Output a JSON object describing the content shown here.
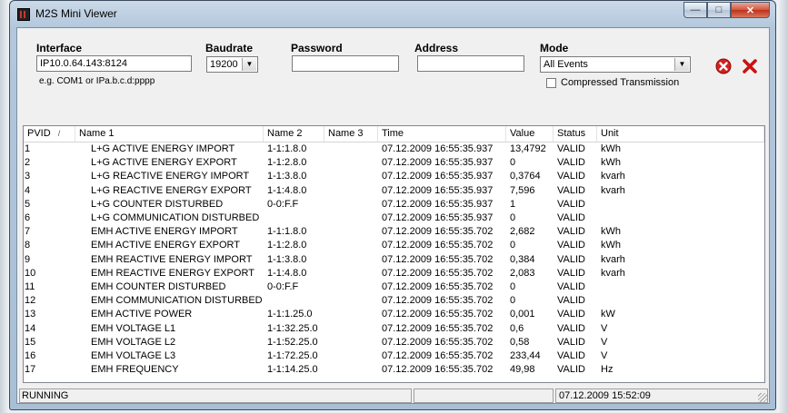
{
  "window": {
    "title": "M2S Mini Viewer"
  },
  "interface": {
    "label": "Interface",
    "value": "IP10.0.64.143:8124",
    "hint": "e.g. COM1 or IPa.b.c.d:pppp"
  },
  "baudrate": {
    "label": "Baudrate",
    "value": "19200"
  },
  "password": {
    "label": "Password",
    "value": ""
  },
  "address": {
    "label": "Address",
    "value": ""
  },
  "mode": {
    "label": "Mode",
    "value": "All Events",
    "compressed_label": "Compressed Transmission",
    "compressed_checked": false
  },
  "table": {
    "columns": [
      "PVID",
      "Name 1",
      "Name 2",
      "Name 3",
      "Time",
      "Value",
      "Status",
      "Unit"
    ],
    "sort_indicator": "/",
    "rows": [
      [
        "1",
        "L+G ACTIVE ENERGY IMPORT",
        "1-1:1.8.0",
        "",
        "07.12.2009 16:55:35.937",
        "13,4792",
        "VALID",
        "kWh"
      ],
      [
        "2",
        "L+G ACTIVE ENERGY EXPORT",
        "1-1:2.8.0",
        "",
        "07.12.2009 16:55:35.937",
        "0",
        "VALID",
        "kWh"
      ],
      [
        "3",
        "L+G REACTIVE ENERGY IMPORT",
        "1-1:3.8.0",
        "",
        "07.12.2009 16:55:35.937",
        "0,3764",
        "VALID",
        "kvarh"
      ],
      [
        "4",
        "L+G REACTIVE ENERGY EXPORT",
        "1-1:4.8.0",
        "",
        "07.12.2009 16:55:35.937",
        "7,596",
        "VALID",
        "kvarh"
      ],
      [
        "5",
        "L+G  COUNTER DISTURBED",
        "0-0:F.F",
        "",
        "07.12.2009 16:55:35.937",
        "1",
        "VALID",
        ""
      ],
      [
        "6",
        "L+G  COMMUNICATION DISTURBED",
        "",
        "",
        "07.12.2009 16:55:35.937",
        "0",
        "VALID",
        ""
      ],
      [
        "7",
        "EMH ACTIVE ENERGY IMPORT",
        "1-1:1.8.0",
        "",
        "07.12.2009 16:55:35.702",
        "2,682",
        "VALID",
        "kWh"
      ],
      [
        "8",
        "EMH ACTIVE ENERGY EXPORT",
        "1-1:2.8.0",
        "",
        "07.12.2009 16:55:35.702",
        "0",
        "VALID",
        "kWh"
      ],
      [
        "9",
        "EMH REACTIVE ENERGY IMPORT",
        "1-1:3.8.0",
        "",
        "07.12.2009 16:55:35.702",
        "0,384",
        "VALID",
        "kvarh"
      ],
      [
        "10",
        "EMH REACTIVE ENERGY EXPORT",
        "1-1:4.8.0",
        "",
        "07.12.2009 16:55:35.702",
        "2,083",
        "VALID",
        "kvarh"
      ],
      [
        "11",
        "EMH COUNTER DISTURBED",
        "0-0:F.F",
        "",
        "07.12.2009 16:55:35.702",
        "0",
        "VALID",
        ""
      ],
      [
        "12",
        "EMH COMMUNICATION DISTURBED",
        "",
        "",
        "07.12.2009 16:55:35.702",
        "0",
        "VALID",
        ""
      ],
      [
        "13",
        "EMH ACTIVE POWER",
        "1-1:1.25.0",
        "",
        "07.12.2009 16:55:35.702",
        "0,001",
        "VALID",
        "kW"
      ],
      [
        "14",
        "EMH VOLTAGE L1",
        "1-1:32.25.0",
        "",
        "07.12.2009 16:55:35.702",
        "0,6",
        "VALID",
        "V"
      ],
      [
        "15",
        "EMH VOLTAGE L2",
        "1-1:52.25.0",
        "",
        "07.12.2009 16:55:35.702",
        "0,58",
        "VALID",
        "V"
      ],
      [
        "16",
        "EMH VOLTAGE L3",
        "1-1:72.25.0",
        "",
        "07.12.2009 16:55:35.702",
        "233,44",
        "VALID",
        "V"
      ],
      [
        "17",
        "EMH FREQUENCY",
        "1-1:14.25.0",
        "",
        "07.12.2009 16:55:35.702",
        "49,98",
        "VALID",
        "Hz"
      ]
    ]
  },
  "status": {
    "state": "RUNNING",
    "middle": "",
    "datetime": "07.12.2009 15:52:09"
  },
  "icons": {
    "stop": "stop-circle-icon",
    "cancel": "red-x-icon"
  },
  "colors": {
    "stop_red": "#d42020",
    "cancel_red": "#cc1111"
  }
}
